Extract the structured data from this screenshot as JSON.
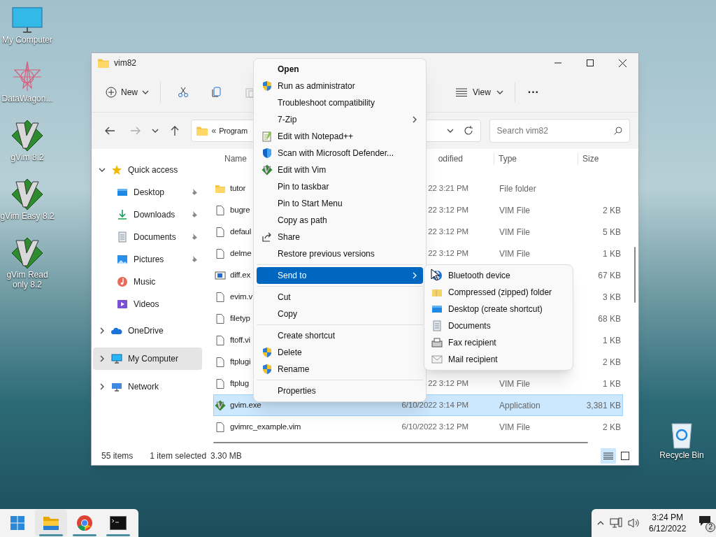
{
  "desktop_icons": [
    {
      "label": "My Computer",
      "kind": "monitor"
    },
    {
      "label": "DataWagon...",
      "kind": "star"
    },
    {
      "label": "gVim 8.2",
      "kind": "vim"
    },
    {
      "label": "gVim Easy 8.2",
      "kind": "vim"
    },
    {
      "label": "gVim Read only 8.2",
      "kind": "vim"
    }
  ],
  "recycle_bin": {
    "label": "Recycle Bin"
  },
  "window": {
    "title": "vim82"
  },
  "toolbar": {
    "new": "New",
    "view": "View",
    "more": "···"
  },
  "address": {
    "prefix": "«",
    "path": "Program",
    "search_placeholder": "Search vim82"
  },
  "sidebar": {
    "items": [
      {
        "label": "Quick access",
        "kind": "star",
        "expanded": true,
        "selected": false,
        "children": [
          {
            "label": "Desktop",
            "kind": "desktop",
            "pinned": true
          },
          {
            "label": "Downloads",
            "kind": "download",
            "pinned": true
          },
          {
            "label": "Documents",
            "kind": "documents",
            "pinned": true
          },
          {
            "label": "Pictures",
            "kind": "pictures",
            "pinned": true
          },
          {
            "label": "Music",
            "kind": "music",
            "pinned": false
          },
          {
            "label": "Videos",
            "kind": "videos",
            "pinned": false
          }
        ]
      },
      {
        "label": "OneDrive",
        "kind": "cloud",
        "expanded": false,
        "selected": false
      },
      {
        "label": "My Computer",
        "kind": "monitor",
        "expanded": false,
        "selected": true
      },
      {
        "label": "Network",
        "kind": "network",
        "expanded": false,
        "selected": false
      }
    ]
  },
  "table": {
    "columns": [
      "Name",
      "odified",
      "Type",
      "Size"
    ],
    "rows": [
      {
        "name": "tutor",
        "date": "22 3:21 PM",
        "type": "File folder",
        "size": "",
        "kind": "folder",
        "selected": false
      },
      {
        "name": "bugre",
        "date": "22 3:12 PM",
        "type": "VIM File",
        "size": "2 KB",
        "kind": "file",
        "selected": false
      },
      {
        "name": "defaul",
        "date": "22 3:12 PM",
        "type": "VIM File",
        "size": "5 KB",
        "kind": "file",
        "selected": false
      },
      {
        "name": "delme",
        "date": "22 3:12 PM",
        "type": "VIM File",
        "size": "1 KB",
        "kind": "file",
        "selected": false
      },
      {
        "name": "diff.ex",
        "date": "",
        "type": "",
        "size": "67 KB",
        "kind": "exe",
        "selected": false
      },
      {
        "name": "evim.v",
        "date": "",
        "type": "",
        "size": "3 KB",
        "kind": "file",
        "selected": false
      },
      {
        "name": "filetyp",
        "date": "",
        "type": "",
        "size": "68 KB",
        "kind": "file",
        "selected": false
      },
      {
        "name": "ftoff.vi",
        "date": "",
        "type": "",
        "size": "1 KB",
        "kind": "file",
        "selected": false
      },
      {
        "name": "ftplugi",
        "date": "",
        "type": "",
        "size": "2 KB",
        "kind": "file",
        "selected": false
      },
      {
        "name": "ftplug",
        "date": "22 3:12 PM",
        "type": "VIM File",
        "size": "1 KB",
        "kind": "file",
        "selected": false
      },
      {
        "name": "gvim.exe",
        "date": "6/10/2022 3:14 PM",
        "type": "Application",
        "size": "3,381 KB",
        "kind": "vim",
        "selected": true
      },
      {
        "name": "gvimrc_example.vim",
        "date": "6/10/2022 3:12 PM",
        "type": "VIM File",
        "size": "2 KB",
        "kind": "file",
        "selected": false
      }
    ]
  },
  "status_bar": {
    "count": "55 items",
    "selection": "1 item selected",
    "size": "3.30 MB",
    "views": [
      {
        "kind": "details",
        "selected": true
      },
      {
        "kind": "tiles",
        "selected": false
      }
    ]
  },
  "context_menu": {
    "groups": [
      {
        "items": [
          {
            "label": "Open",
            "kind": "plain",
            "bold": true,
            "submenu": false,
            "selected": false
          },
          {
            "label": "Run as administrator",
            "kind": "shield",
            "bold": false,
            "submenu": false,
            "selected": false
          },
          {
            "label": "Troubleshoot compatibility",
            "kind": "plain",
            "bold": false,
            "submenu": false,
            "selected": false
          },
          {
            "label": "7-Zip",
            "kind": "plain",
            "bold": false,
            "submenu": true,
            "selected": false
          },
          {
            "label": "Edit with Notepad++",
            "kind": "notepad",
            "bold": false,
            "submenu": false,
            "selected": false
          },
          {
            "label": "Scan with Microsoft Defender...",
            "kind": "defender",
            "bold": false,
            "submenu": false,
            "selected": false
          },
          {
            "label": "Edit with Vim",
            "kind": "vim",
            "bold": false,
            "submenu": false,
            "selected": false
          },
          {
            "label": "Pin to taskbar",
            "kind": "plain",
            "bold": false,
            "submenu": false,
            "selected": false
          },
          {
            "label": "Pin to Start Menu",
            "kind": "plain",
            "bold": false,
            "submenu": false,
            "selected": false
          },
          {
            "label": "Copy as path",
            "kind": "plain",
            "bold": false,
            "submenu": false,
            "selected": false
          },
          {
            "label": "Share",
            "kind": "share",
            "bold": false,
            "submenu": false,
            "selected": false
          },
          {
            "label": "Restore previous versions",
            "kind": "plain",
            "bold": false,
            "submenu": false,
            "selected": false
          }
        ]
      },
      {
        "items": [
          {
            "label": "Send to",
            "kind": "plain",
            "bold": false,
            "submenu": true,
            "selected": true
          }
        ]
      },
      {
        "items": [
          {
            "label": "Cut",
            "kind": "plain",
            "bold": false,
            "submenu": false,
            "selected": false
          },
          {
            "label": "Copy",
            "kind": "plain",
            "bold": false,
            "submenu": false,
            "selected": false
          }
        ]
      },
      {
        "items": [
          {
            "label": "Create shortcut",
            "kind": "plain",
            "bold": false,
            "submenu": false,
            "selected": false
          },
          {
            "label": "Delete",
            "kind": "shield",
            "bold": false,
            "submenu": false,
            "selected": false
          },
          {
            "label": "Rename",
            "kind": "shield",
            "bold": false,
            "submenu": false,
            "selected": false
          }
        ]
      },
      {
        "items": [
          {
            "label": "Properties",
            "kind": "plain",
            "bold": false,
            "submenu": false,
            "selected": false
          }
        ]
      }
    ]
  },
  "send_to_menu": {
    "items": [
      {
        "label": "Bluetooth device",
        "kind": "bluetooth"
      },
      {
        "label": "Compressed (zipped) folder",
        "kind": "zip"
      },
      {
        "label": "Desktop (create shortcut)",
        "kind": "desktop"
      },
      {
        "label": "Documents",
        "kind": "documents"
      },
      {
        "label": "Fax recipient",
        "kind": "fax"
      },
      {
        "label": "Mail recipient",
        "kind": "mail"
      }
    ]
  },
  "taskbar": {
    "apps": [
      {
        "kind": "start",
        "running": false
      },
      {
        "kind": "explorer",
        "running": true
      },
      {
        "kind": "browser",
        "running": true
      },
      {
        "kind": "terminal",
        "running": true
      }
    ],
    "time": "3:24 PM",
    "date": "6/12/2022",
    "notifications": "2"
  }
}
